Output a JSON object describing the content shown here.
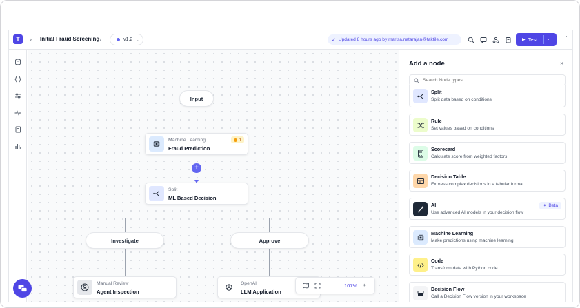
{
  "header": {
    "logo_glyph": "T",
    "flow_title": "Initial Fraud Screening",
    "version": "v1.2",
    "updated_text": "Updated 8 hours ago by marisa.natarajan@taktile.com",
    "test_label": "Test"
  },
  "canvas": {
    "input_label": "Input",
    "nodes": [
      {
        "type": "Machine Learning",
        "name": "Fraud Prediction",
        "badge": "1"
      },
      {
        "type": "Split",
        "name": "ML Based Decision"
      },
      {
        "type": "Manual Review",
        "name": "Agent Inspection"
      },
      {
        "type": "OpenAI",
        "name": "LLM Application"
      }
    ],
    "branches": [
      "Investigate",
      "Approve"
    ],
    "add_glyph": "+",
    "zoom": {
      "minus": "−",
      "value": "107%",
      "plus": "+"
    }
  },
  "panel": {
    "title": "Add a node",
    "close": "×",
    "search_placeholder": "Search Node types...",
    "beta_label": "Beta",
    "items": [
      {
        "name": "Split",
        "desc": "Split data based on conditions",
        "icon": "split-icon",
        "color": "#e0e7ff"
      },
      {
        "name": "Rule",
        "desc": "Set values based on conditions",
        "icon": "shuffle-icon",
        "color": "#ecfccb"
      },
      {
        "name": "Scorecard",
        "desc": "Calculate score from weighted factors",
        "icon": "calculator-icon",
        "color": "#dcfce7"
      },
      {
        "name": "Decision Table",
        "desc": "Express complex decisions in a tabular format",
        "icon": "table-icon",
        "color": "#fed7aa"
      },
      {
        "name": "AI",
        "desc": "Use advanced AI models in your decision flow",
        "icon": "magic-wand-icon",
        "color": "#1f2937"
      },
      {
        "name": "Machine Learning",
        "desc": "Make predictions using machine learning",
        "icon": "chip-icon",
        "color": "#dbeafe"
      },
      {
        "name": "Code",
        "desc": "Transform data with Python code",
        "icon": "code-icon",
        "color": "#fef08a"
      },
      {
        "name": "Decision Flow",
        "desc": "Call a Decision Flow version in your workspace",
        "icon": "flow-icon",
        "color": "#f3f4f6"
      }
    ]
  }
}
